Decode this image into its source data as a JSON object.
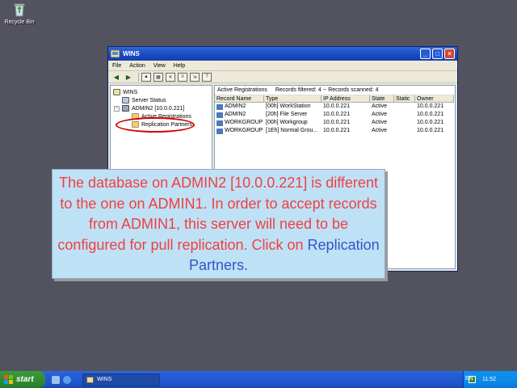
{
  "desktop": {
    "recycle_bin_label": "Recycle Bin"
  },
  "window": {
    "title": "WINS",
    "controls": {
      "minimize": "_",
      "maximize": "□",
      "close": "×"
    },
    "menu": [
      "File",
      "Action",
      "View",
      "Help"
    ],
    "tree": {
      "root": "WINS",
      "server_status": "Server Status",
      "server": "ADMIN2 [10.0.0.221]",
      "active_registrations": "Active Registrations",
      "replication_partners": "Replication Partners"
    },
    "list_header": {
      "title": "Active Registrations",
      "filtered": "Records filtered: 4 -- Records scanned: 4"
    },
    "columns": [
      "Record Name",
      "Type",
      "IP Address",
      "State",
      "Static",
      "Owner"
    ],
    "rows": [
      {
        "name": "ADMIN2",
        "type": "[00h] WorkStation",
        "ip": "10.0.0.221",
        "state": "Active",
        "static": "",
        "owner": "10.0.0.221"
      },
      {
        "name": "ADMIN2",
        "type": "[20h] File Server",
        "ip": "10.0.0.221",
        "state": "Active",
        "static": "",
        "owner": "10.0.0.221"
      },
      {
        "name": "WORKGROUP",
        "type": "[00h] Workgroup",
        "ip": "10.0.0.221",
        "state": "Active",
        "static": "",
        "owner": "10.0.0.221"
      },
      {
        "name": "WORKGROUP",
        "type": "[1Eh] Normal Grou...",
        "ip": "10.0.0.221",
        "state": "Active",
        "static": "",
        "owner": "10.0.0.221"
      }
    ]
  },
  "callout": {
    "text": "The database on ADMIN2 [10.0.0.221] is different to the one on ADMIN1. In order to accept records from ADMIN1, this server will need to be configured for pull replication. Click on ",
    "link": "Replication Partners",
    "end": "."
  },
  "taskbar": {
    "start_label": "start",
    "task_label": "WINS",
    "language": "EN",
    "clock": "11:52"
  },
  "colors": {
    "highlight": "#d40000",
    "callout_text": "#f04040",
    "callout_link": "#3355c8"
  }
}
